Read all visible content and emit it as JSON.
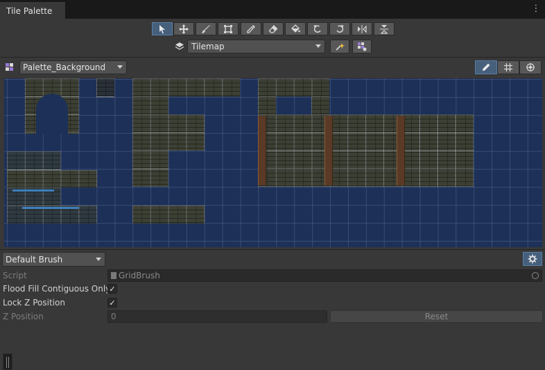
{
  "window": {
    "tab_title": "Tile Palette",
    "more_glyph": "⋮"
  },
  "toolbar": {
    "tools": [
      {
        "icon": "select-arrow-icon",
        "active": true
      },
      {
        "icon": "move-icon",
        "active": false
      },
      {
        "icon": "paint-brush-icon",
        "active": false
      },
      {
        "icon": "box-fill-icon",
        "active": false
      },
      {
        "icon": "eyedropper-icon",
        "active": false
      },
      {
        "icon": "eraser-icon",
        "active": false
      },
      {
        "icon": "flood-fill-bucket-icon",
        "active": false
      },
      {
        "icon": "rotate-counterclockwise-icon",
        "active": false
      },
      {
        "icon": "rotate-clockwise-icon",
        "active": false
      },
      {
        "icon": "flip-x-icon",
        "active": false
      },
      {
        "icon": "flip-y-icon",
        "active": false
      }
    ],
    "target_value": "Tilemap"
  },
  "palette": {
    "selected": "Palette_Background",
    "view_buttons": [
      {
        "icon": "edit-pencil-icon",
        "active": true
      },
      {
        "icon": "grid-icon",
        "active": false
      },
      {
        "icon": "gizmo-icon",
        "active": false
      }
    ]
  },
  "inspector": {
    "brush_value": "Default Brush",
    "script_label": "Script",
    "script_value": "GridBrush",
    "flood_fill_label": "Flood Fill Contiguous Only",
    "flood_fill_checked": "✓",
    "lock_z_label": "Lock Z Position",
    "lock_z_checked": "✓",
    "z_position_label": "Z Position",
    "z_position_value": "0",
    "reset_label": "Reset"
  },
  "colors": {
    "accent": "#46607c",
    "palette_background": "#1d3058",
    "panel": "#383838"
  }
}
